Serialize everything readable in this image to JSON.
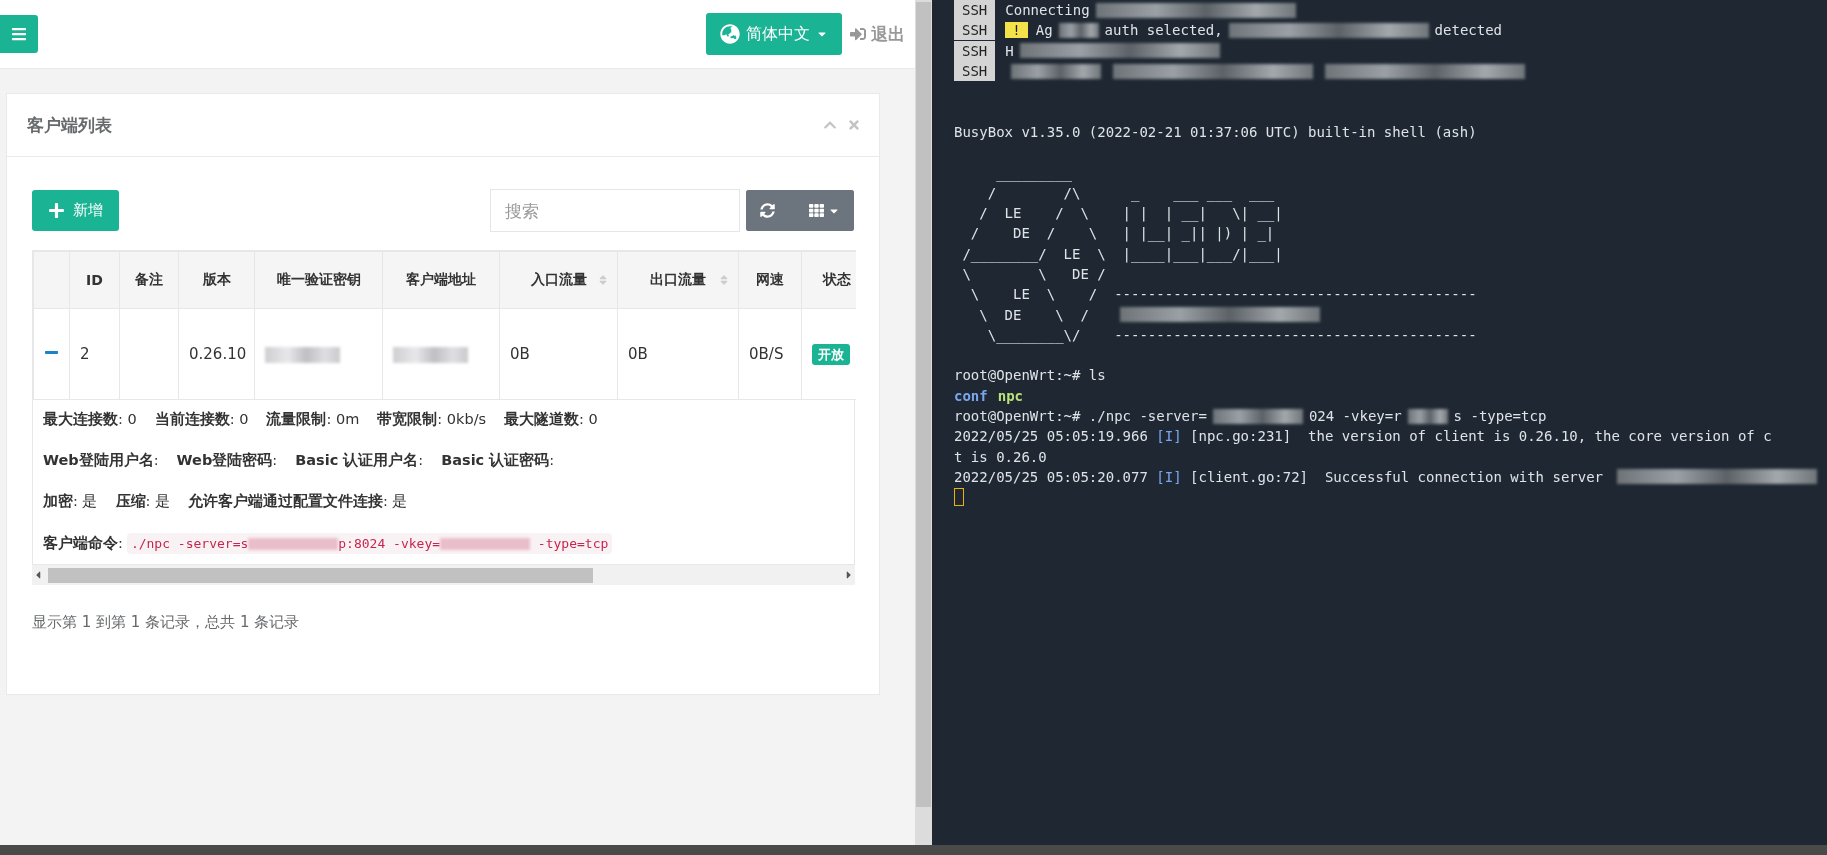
{
  "header": {
    "language_button": "简体中文",
    "logout": "退出"
  },
  "card": {
    "title": "客户端列表",
    "toolbar": {
      "add_button": "新增",
      "search": {
        "placeholder": "搜索"
      }
    },
    "table": {
      "columns": [
        {
          "label": "ID",
          "sortable": false
        },
        {
          "label": "备注",
          "sortable": false
        },
        {
          "label": "版本",
          "sortable": false
        },
        {
          "label": "唯一验证密钥",
          "sortable": false
        },
        {
          "label": "客户端地址",
          "sortable": false
        },
        {
          "label": "入口流量",
          "sortable": true
        },
        {
          "label": "出口流量",
          "sortable": true
        },
        {
          "label": "网速",
          "sortable": false
        },
        {
          "label": "状态",
          "sortable": false
        }
      ],
      "rows": [
        {
          "expanded": true,
          "cells": [
            {
              "kind": "text",
              "text": "2"
            },
            {
              "kind": "empty"
            },
            {
              "kind": "text",
              "text": "0.26.10"
            },
            {
              "kind": "blurred"
            },
            {
              "kind": "blurred"
            },
            {
              "kind": "text",
              "text": "0B"
            },
            {
              "kind": "text",
              "text": "0B"
            },
            {
              "kind": "text",
              "text": "0B/S"
            },
            {
              "kind": "badge",
              "text": "开放"
            }
          ],
          "detail": {
            "lines": [
              [
                "**最大连接数**: 0",
                "**当前连接数**: 0",
                "**流量限制**: 0m",
                "**带宽限制**: 0kb/s",
                "**最大隧道数**: 0"
              ],
              [
                "**Web登陆用户名**:",
                "**Web登陆密码**:",
                "**Basic 认证用户名**:",
                "**Basic 认证密码**:"
              ],
              [
                "**加密**: 是",
                "**压缩**: 是",
                "**允许客户端通过配置文件连接**: 是"
              ]
            ],
            "command_label": "**客户端命令**:",
            "command": [
              {
                "kind": "text",
                "text": "./npc -server=s"
              },
              {
                "kind": "blur_m"
              },
              {
                "kind": "text",
                "text": "p:8024 -vkey="
              },
              {
                "kind": "blur_m"
              },
              {
                "kind": "text",
                "text": " -type=tcp"
              }
            ]
          }
        }
      ]
    },
    "footer": "显示第 1 到第 1 条记录，总共 1 条记录"
  },
  "terminal": {
    "lines": [
      [
        {
          "kind": "tag",
          "text": "SSH"
        },
        {
          "kind": "text",
          "text": "Connecting"
        },
        {
          "kind": "blur_l"
        }
      ],
      [
        {
          "kind": "tag",
          "text": "SSH"
        },
        {
          "kind": "warn",
          "text": "!"
        },
        {
          "kind": "text",
          "text": "Ag"
        },
        {
          "kind": "blur_s"
        },
        {
          "kind": "text",
          "text": "auth selected,"
        },
        {
          "kind": "blur_l"
        },
        {
          "kind": "text",
          "text": "detected"
        }
      ],
      [
        {
          "kind": "tag",
          "text": "SSH"
        },
        {
          "kind": "text",
          "text": "H"
        },
        {
          "kind": "blur_l"
        }
      ],
      [
        {
          "kind": "tag",
          "text": "SSH"
        },
        {
          "kind": "blur_m"
        },
        {
          "kind": "blur_l"
        },
        {
          "kind": "blur_l"
        }
      ],
      [
        {
          "kind": "blank"
        }
      ],
      [
        {
          "kind": "blank"
        }
      ],
      [
        {
          "kind": "text",
          "text": "BusyBox v1.35.0 (2022-02-21 01:37:06 UTC) built-in shell (ash)"
        }
      ],
      [
        {
          "kind": "blank"
        }
      ],
      [
        {
          "kind": "text",
          "text": "     _________"
        }
      ],
      [
        {
          "kind": "text",
          "text": "    /        /\\      _    ___ ___  ___"
        }
      ],
      [
        {
          "kind": "text",
          "text": "   /  LE    /  \\    | |  | __|   \\| __|"
        }
      ],
      [
        {
          "kind": "text",
          "text": "  /    DE  /    \\   | |__| _|| |) | _|"
        }
      ],
      [
        {
          "kind": "text",
          "text": " /________/  LE  \\  |____|___|___/|___|"
        }
      ],
      [
        {
          "kind": "text",
          "text": " \\        \\   DE /"
        }
      ],
      [
        {
          "kind": "text",
          "text": "  \\    LE  \\    /  -------------------------------------------"
        }
      ],
      [
        {
          "kind": "text",
          "text": "   \\  DE    \\  /   "
        },
        {
          "kind": "blur_l"
        }
      ],
      [
        {
          "kind": "text",
          "text": "    \\________\\/    -------------------------------------------"
        }
      ],
      [
        {
          "kind": "blank"
        }
      ],
      [
        {
          "kind": "text",
          "text": "root@OpenWrt:~# ls"
        }
      ],
      [
        {
          "kind": "dir",
          "text": "conf"
        },
        {
          "kind": "exec",
          "text": "npc"
        }
      ],
      [
        {
          "kind": "text",
          "text": "root@OpenWrt:~# ./npc -server="
        },
        {
          "kind": "blur_m"
        },
        {
          "kind": "text",
          "text": "024 -vkey=r"
        },
        {
          "kind": "blur_s"
        },
        {
          "kind": "text",
          "text": "s -type=tcp"
        }
      ],
      [
        {
          "kind": "text",
          "text": "2022/05/25 05:05:19.966 "
        },
        {
          "kind": "level",
          "text": "[I]"
        },
        {
          "kind": "text",
          "text": " [npc.go:231]  the version of client is 0.26.10, the core version of c"
        }
      ],
      [
        {
          "kind": "text",
          "text": "t is 0.26.0"
        }
      ],
      [
        {
          "kind": "text",
          "text": "2022/05/25 05:05:20.077 "
        },
        {
          "kind": "level",
          "text": "[I]"
        },
        {
          "kind": "text",
          "text": " [client.go:72]  Successful connection with server "
        },
        {
          "kind": "blur_l"
        }
      ],
      [
        {
          "kind": "cursor"
        }
      ]
    ]
  }
}
